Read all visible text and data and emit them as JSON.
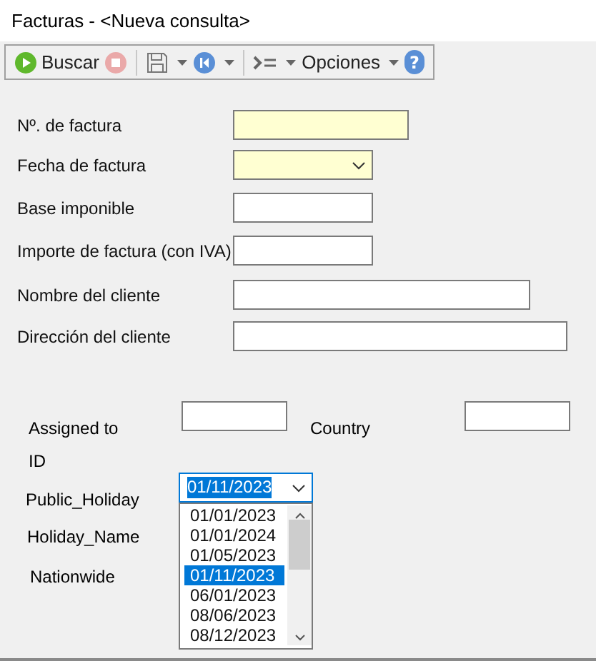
{
  "window": {
    "title": "Facturas - <Nueva consulta>"
  },
  "toolbar": [
    {
      "kind": "play",
      "label": "Buscar",
      "disabled": false
    },
    {
      "kind": "stop",
      "disabled": true
    },
    {
      "kind": "save",
      "dropdown": true
    },
    {
      "kind": "first",
      "dropdown": true
    },
    {
      "kind": "list",
      "dropdown": true
    },
    {
      "kind": "text",
      "label": "Opciones",
      "dropdown": true
    },
    {
      "kind": "help",
      "label": "?"
    }
  ],
  "fields": [
    {
      "label": "Nº. de factura",
      "kind": "text",
      "highlighted": true
    },
    {
      "label": "Fecha de factura",
      "kind": "dropdown",
      "highlighted": true
    },
    {
      "label": "Base imponible",
      "kind": "text",
      "highlighted": false
    },
    {
      "label": "Importe de factura (con IVA)",
      "kind": "text",
      "highlighted": false
    },
    {
      "label": "Nombre del cliente",
      "kind": "text",
      "highlighted": false
    },
    {
      "label": "Dirección del cliente",
      "kind": "text",
      "highlighted": false
    }
  ],
  "custom": {
    "assigned_to": {
      "label_1": "Assigned to",
      "label_2": "ID"
    },
    "country": {
      "label": "Country"
    },
    "public_holiday": {
      "label": "Public_Holiday",
      "value": "01/11/2023",
      "expanded": true,
      "options": [
        {
          "label": "01/01/2023",
          "selected": false
        },
        {
          "label": "01/01/2024",
          "selected": false
        },
        {
          "label": "01/05/2023",
          "selected": false
        },
        {
          "label": "01/11/2023",
          "selected": true
        },
        {
          "label": "06/01/2023",
          "selected": false
        },
        {
          "label": "08/06/2023",
          "selected": false
        },
        {
          "label": "08/12/2023",
          "selected": false
        }
      ]
    },
    "holiday_name": {
      "label": "Holiday_Name"
    },
    "nationwide": {
      "label": "Nationwide"
    }
  }
}
